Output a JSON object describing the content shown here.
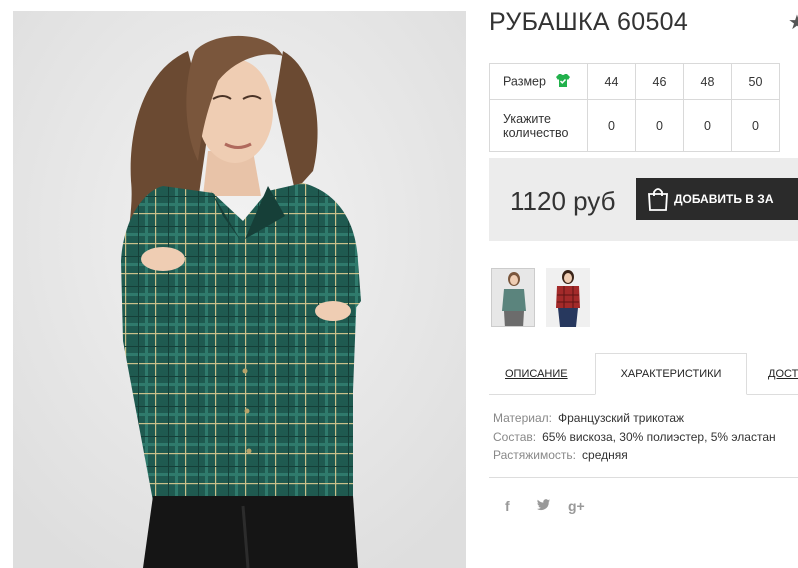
{
  "product": {
    "title": "РУБАШКА 60504",
    "favorite_icon": "star-icon"
  },
  "sizes": {
    "label": "Размер",
    "size_icon": "tshirt-icon",
    "size_icon_color": "#22b14c",
    "values": [
      "44",
      "46",
      "48",
      "50"
    ],
    "qty_label": "Укажите количество",
    "quantities": [
      "0",
      "0",
      "0",
      "0"
    ]
  },
  "price": {
    "value": "1120 руб",
    "add_to_cart": "ДОБАВИТЬ В ЗА",
    "cart_icon": "shopping-bag-icon"
  },
  "thumbnails": [
    {
      "alt": "green-plaid-shirt"
    },
    {
      "alt": "red-plaid-shirt"
    }
  ],
  "tabs": {
    "description": "ОПИСАНИЕ",
    "characteristics": "ХАРАКТЕРИСТИКИ",
    "delivery": "ДОСТА",
    "active": "characteristics"
  },
  "properties": [
    {
      "key": "Материал:",
      "value": "Французский трикотаж"
    },
    {
      "key": "Состав:",
      "value": "65% вискоза, 30% полиэстер, 5% эластан"
    },
    {
      "key": "Растяжимость:",
      "value": "средняя"
    }
  ],
  "social": {
    "facebook": "f",
    "twitter": "twitter-icon",
    "googleplus": "g+"
  },
  "colors": {
    "accent_dark": "#2b2b2b",
    "shirt_green": "#1f5a50",
    "shirt_red": "#a32a2a"
  }
}
